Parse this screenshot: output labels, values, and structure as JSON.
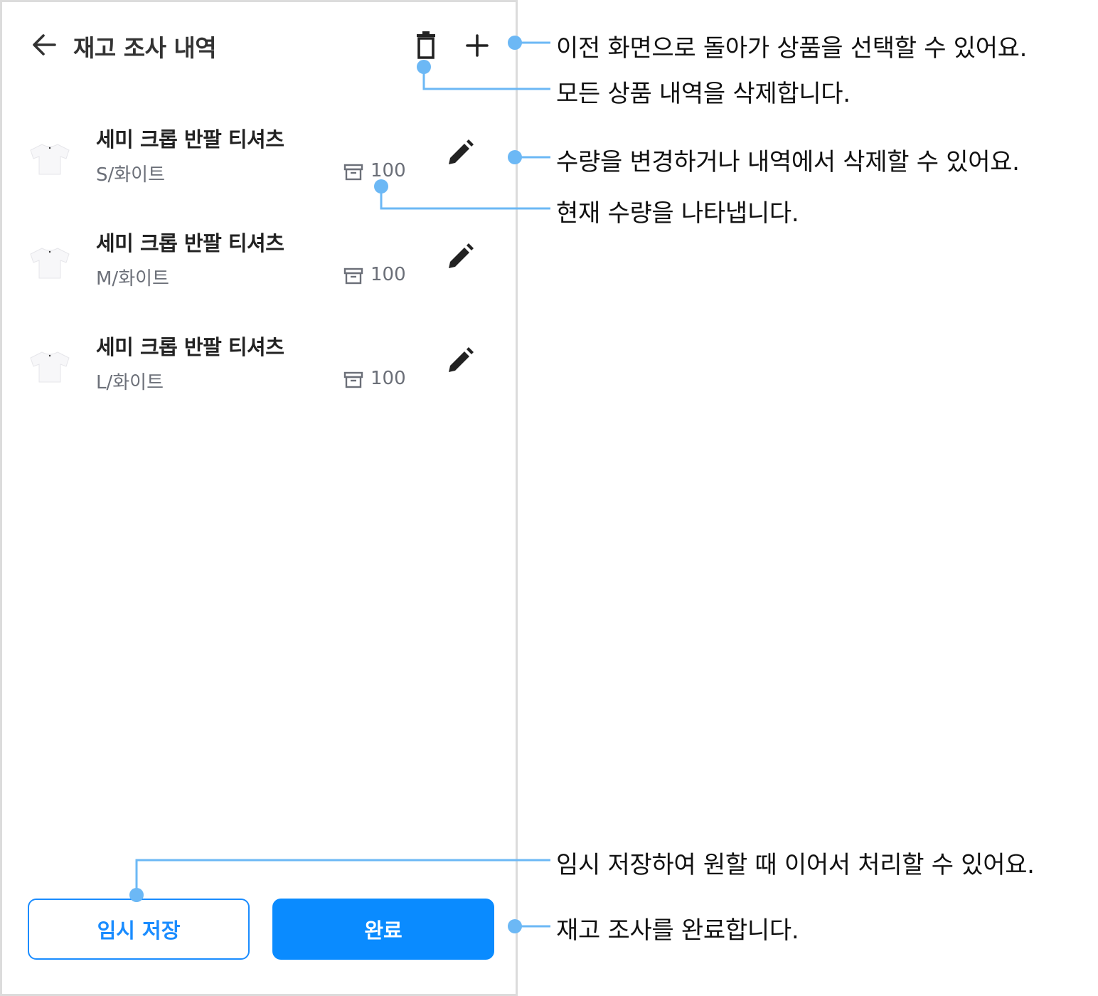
{
  "header": {
    "title": "재고 조사 내역",
    "back_icon": "arrow-left-icon",
    "delete_icon": "trash-icon",
    "add_icon": "plus-icon"
  },
  "items": [
    {
      "name": "세미 크롭 반팔 티셔츠",
      "option": "S/화이트",
      "quantity": "100"
    },
    {
      "name": "세미 크롭 반팔 티셔츠",
      "option": "M/화이트",
      "quantity": "100"
    },
    {
      "name": "세미 크롭 반팔 티셔츠",
      "option": "L/화이트",
      "quantity": "100"
    }
  ],
  "footer": {
    "draft_label": "임시 저장",
    "done_label": "완료"
  },
  "annotations": {
    "add": "이전 화면으로 돌아가 상품을 선택할 수 있어요.",
    "delete_all": "모든 상품 내역을 삭제합니다.",
    "edit": "수량을 변경하거나 내역에서 삭제할 수 있어요.",
    "quantity": "현재 수량을 나타냅니다.",
    "draft": "임시 저장하여 원할 때 이어서 처리할 수 있어요.",
    "done": "재고 조사를 완료합니다."
  },
  "colors": {
    "primary": "#0a8bff",
    "callout": "#6cb8f5",
    "muted_text": "#6b6f78"
  }
}
